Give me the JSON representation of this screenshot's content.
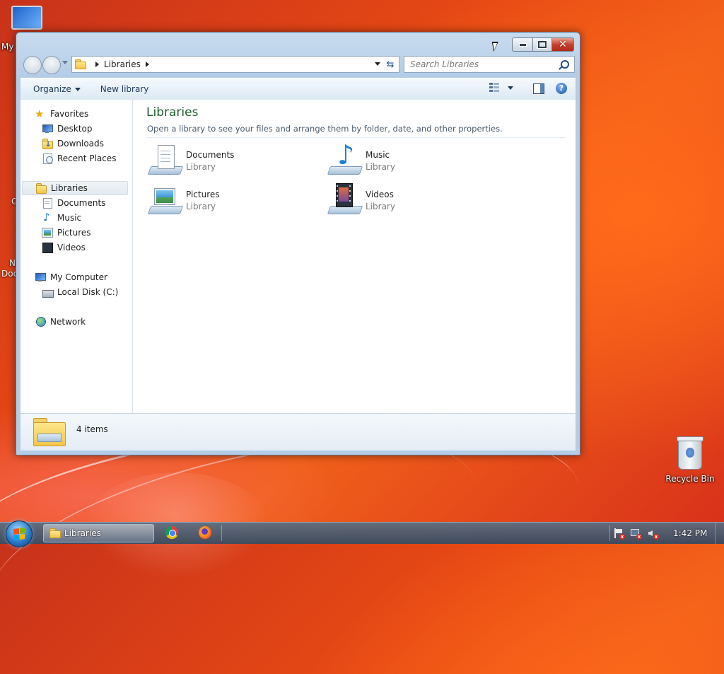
{
  "desktop": {
    "icons": [
      {
        "label": "My"
      },
      {
        "label": "Recycle Bin"
      }
    ],
    "partial_labels": [
      "N",
      "Doc",
      "C"
    ]
  },
  "window": {
    "address": {
      "crumb": "Libraries"
    },
    "search": {
      "placeholder": "Search Libraries"
    },
    "toolbar": {
      "organize": "Organize",
      "new_library": "New library"
    },
    "sidebar": {
      "favorites": {
        "label": "Favorites",
        "items": [
          "Desktop",
          "Downloads",
          "Recent Places"
        ]
      },
      "libraries": {
        "label": "Libraries",
        "items": [
          "Documents",
          "Music",
          "Pictures",
          "Videos"
        ]
      },
      "computer": {
        "label": "My Computer",
        "items": [
          "Local Disk (C:)"
        ]
      },
      "network": {
        "label": "Network"
      }
    },
    "content": {
      "title": "Libraries",
      "subtitle": "Open a library to see your files and arrange them by folder, date, and other properties.",
      "libraries": [
        {
          "name": "Documents",
          "type": "Library",
          "icon": "documents-icon"
        },
        {
          "name": "Music",
          "type": "Library",
          "icon": "music-icon"
        },
        {
          "name": "Pictures",
          "type": "Library",
          "icon": "pictures-icon"
        },
        {
          "name": "Videos",
          "type": "Library",
          "icon": "videos-icon"
        }
      ]
    },
    "status": {
      "text": "4 items"
    }
  },
  "taskbar": {
    "window_button": "Libraries",
    "clock": "1:42 PM"
  },
  "colors": {
    "title_green": "#1e5e2e",
    "toolbar_text": "#1e395b",
    "close_red": "#c8402c"
  }
}
